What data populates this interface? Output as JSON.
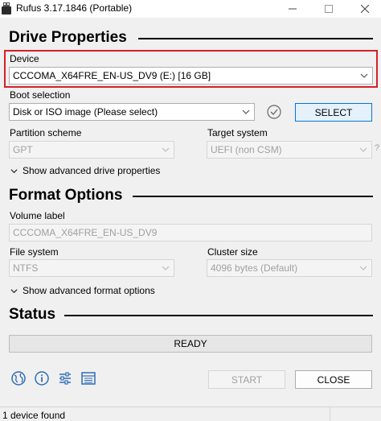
{
  "window": {
    "title": "Rufus 3.17.1846 (Portable)"
  },
  "drive_properties": {
    "heading": "Drive Properties",
    "device_label": "Device",
    "device_value": "CCCOMA_X64FRE_EN-US_DV9 (E:) [16 GB]",
    "boot_selection_label": "Boot selection",
    "boot_selection_value": "Disk or ISO image (Please select)",
    "select_button": "SELECT",
    "partition_scheme_label": "Partition scheme",
    "partition_scheme_value": "GPT",
    "target_system_label": "Target system",
    "target_system_value": "UEFI (non CSM)",
    "target_help": "?",
    "advanced_toggle": "Show advanced drive properties"
  },
  "format_options": {
    "heading": "Format Options",
    "volume_label_label": "Volume label",
    "volume_label_value": "CCCOMA_X64FRE_EN-US_DV9",
    "file_system_label": "File system",
    "file_system_value": "NTFS",
    "cluster_size_label": "Cluster size",
    "cluster_size_value": "4096 bytes (Default)",
    "advanced_toggle": "Show advanced format options"
  },
  "status": {
    "heading": "Status",
    "progress_text": "READY",
    "progress_fraction": 0
  },
  "actions": {
    "start_button": "START",
    "close_button": "CLOSE"
  },
  "toolbar_icons": [
    "globe-icon",
    "info-icon",
    "settings-sliders-icon",
    "log-icon"
  ],
  "statusbar": {
    "text": "1 device found"
  },
  "colors": {
    "highlight_border": "#d71f28",
    "accent": "#0078d7",
    "background": "#f0f0f0"
  }
}
